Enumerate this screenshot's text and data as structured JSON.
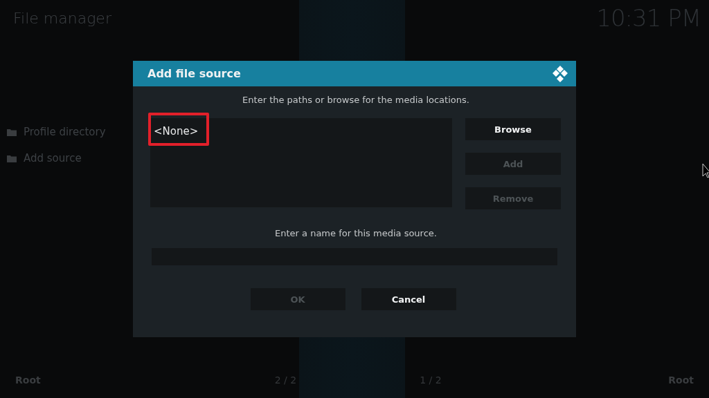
{
  "header": {
    "title": "File manager",
    "clock": "10:31 PM"
  },
  "sources": [
    {
      "label": "Profile directory"
    },
    {
      "label": "Add source"
    }
  ],
  "dialog": {
    "title": "Add file source",
    "paths_prompt": "Enter the paths or browse for the media locations.",
    "paths": [
      {
        "label": "<None>",
        "highlighted": true
      }
    ],
    "side_buttons": [
      {
        "label": "Browse",
        "disabled": false
      },
      {
        "label": "Add",
        "disabled": true
      },
      {
        "label": "Remove",
        "disabled": true
      }
    ],
    "name_prompt": "Enter a name for this media source.",
    "actions": [
      {
        "label": "OK",
        "disabled": true
      },
      {
        "label": "Cancel",
        "disabled": false
      }
    ]
  },
  "footer": {
    "left": "Root",
    "page_left": "2 / 2",
    "page_right": "1 / 2",
    "right": "Root"
  }
}
